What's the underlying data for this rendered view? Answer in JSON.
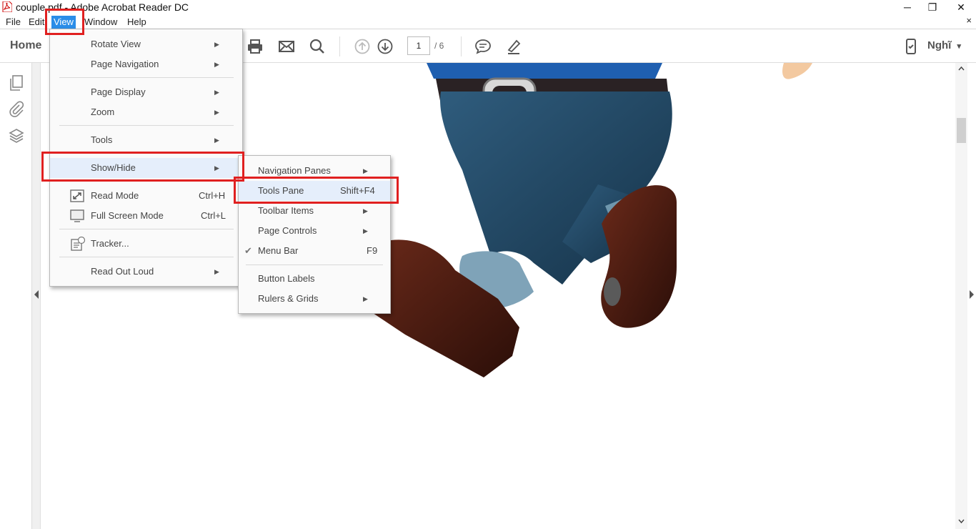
{
  "window": {
    "title": "couple.pdf - Adobe Acrobat Reader DC",
    "minimize": "─",
    "restore": "❐",
    "close": "✕"
  },
  "menubar": {
    "items": [
      "File",
      "Edit",
      "View",
      "Window",
      "Help"
    ],
    "active": "View",
    "doc_close": "×"
  },
  "toolbar": {
    "home": "Home",
    "page_current": "1",
    "page_total": "/ 6",
    "user": "Nghĩ",
    "user_caret": "▾"
  },
  "view_menu": {
    "items": [
      {
        "label": "Rotate View",
        "submenu": true
      },
      {
        "label": "Page Navigation",
        "submenu": true
      },
      {
        "label": "Page Display",
        "submenu": true
      },
      {
        "label": "Zoom",
        "submenu": true
      },
      {
        "label": "Tools",
        "submenu": true
      },
      {
        "label": "Show/Hide",
        "submenu": true,
        "highlighted": true
      },
      {
        "label": "Read Mode",
        "shortcut": "Ctrl+H",
        "icon": "read-mode-icon"
      },
      {
        "label": "Full Screen Mode",
        "shortcut": "Ctrl+L",
        "icon": "full-screen-icon"
      },
      {
        "label": "Tracker...",
        "icon": "tracker-icon"
      },
      {
        "label": "Read Out Loud",
        "submenu": true
      }
    ]
  },
  "showhide_menu": {
    "items": [
      {
        "label": "Navigation Panes",
        "submenu": true
      },
      {
        "label": "Tools Pane",
        "shortcut": "Shift+F4",
        "highlighted": true
      },
      {
        "label": "Toolbar Items",
        "submenu": true
      },
      {
        "label": "Page Controls",
        "submenu": true
      },
      {
        "label": "Menu Bar",
        "shortcut": "F9",
        "checked": true
      },
      {
        "label": "Button Labels"
      },
      {
        "label": "Rulers & Grids",
        "submenu": true
      }
    ]
  },
  "colors": {
    "menu_active": "#2a8de8",
    "annotation_red": "#e02020",
    "highlight": "#e5eefb"
  }
}
